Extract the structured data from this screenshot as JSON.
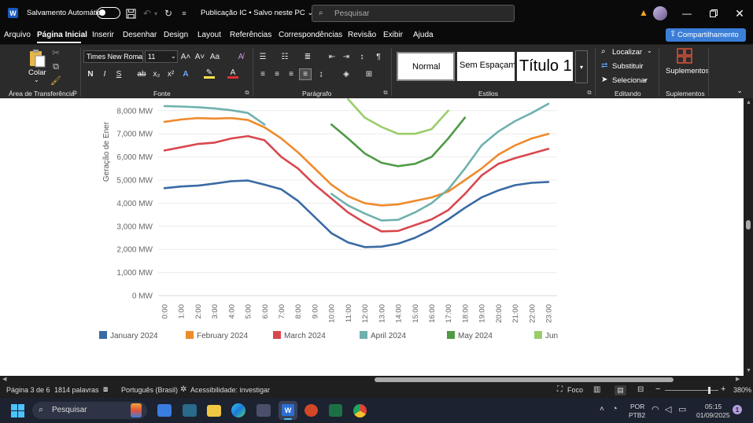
{
  "titlebar": {
    "autosave_label": "Salvamento Automático",
    "doc_title": "Publicação IC",
    "save_status": "Salvo neste PC",
    "search_placeholder": "Pesquisar"
  },
  "menu": {
    "tabs": [
      "Arquivo",
      "Página Inicial",
      "Inserir",
      "Desenhar",
      "Design",
      "Layout",
      "Referências",
      "Correspondências",
      "Revisão",
      "Exibir",
      "Ajuda"
    ],
    "share_label": "Compartilhamento"
  },
  "ribbon": {
    "paste_label": "Colar",
    "clipboard_group": "Área de Transferência",
    "font_name": "Times New Roma",
    "font_size": "11",
    "font_group": "Fonte",
    "paragraph_group": "Parágrafo",
    "styles": [
      "Normal",
      "Sem Espaçam",
      "Título 1"
    ],
    "styles_group": "Estilos",
    "find_label": "Localizar",
    "replace_label": "Substituir",
    "select_label": "Selecionar",
    "editing_group": "Editando",
    "addins_label": "Suplementos",
    "addins_group": "Suplementos"
  },
  "chart_data": {
    "type": "line",
    "ylabel": "Geração de Ener",
    "y_ticks": [
      "0 MW",
      "1,000 MW",
      "2,000 MW",
      "3,000 MW",
      "4,000 MW",
      "5,000 MW",
      "6,000 MW",
      "7,000 MW",
      "8,000 MW"
    ],
    "ylim": [
      0,
      8200
    ],
    "categories": [
      "0:00",
      "1:00",
      "2:00",
      "3:00",
      "4:00",
      "5:00",
      "6:00",
      "7:00",
      "8:00",
      "9:00",
      "10:00",
      "11:00",
      "12:00",
      "13:00",
      "14:00",
      "15:00",
      "16:00",
      "17:00",
      "18:00",
      "19:00",
      "20:00",
      "21:00",
      "22:00",
      "23:00"
    ],
    "grid": true,
    "legend_position": "bottom",
    "series": [
      {
        "name": "January 2024",
        "color": "#3a6aa4",
        "values": [
          4650,
          4720,
          4760,
          4850,
          4950,
          4980,
          4800,
          4600,
          4100,
          3400,
          2700,
          2300,
          2100,
          2120,
          2250,
          2500,
          2850,
          3300,
          3800,
          4250,
          4550,
          4780,
          4880,
          4920
        ]
      },
      {
        "name": "February 2024",
        "color": "#ef8b2c",
        "values": [
          7520,
          7620,
          7680,
          7660,
          7680,
          7600,
          7280,
          6800,
          6200,
          5500,
          4800,
          4300,
          4000,
          3900,
          3950,
          4100,
          4250,
          4500,
          5000,
          5500,
          6100,
          6500,
          6800,
          7000
        ]
      },
      {
        "name": "March 2024",
        "color": "#d9474e",
        "values": [
          6280,
          6420,
          6560,
          6620,
          6800,
          6900,
          6720,
          6000,
          5500,
          4800,
          4200,
          3600,
          3150,
          2780,
          2800,
          3050,
          3300,
          3700,
          4400,
          5200,
          5700,
          5950,
          6150,
          6350
        ]
      },
      {
        "name": "April 2024",
        "color": "#6fb1ad",
        "values": [
          8200,
          8180,
          8150,
          8100,
          8020,
          7900,
          7400,
          null,
          null,
          null,
          4400,
          3900,
          3550,
          3250,
          3280,
          3600,
          4000,
          4600,
          5500,
          6500,
          7100,
          7550,
          7900,
          8300
        ]
      },
      {
        "name": "May 2024",
        "color": "#4f9a46",
        "values": [
          null,
          null,
          null,
          null,
          null,
          null,
          null,
          null,
          null,
          null,
          7400,
          6800,
          6150,
          5750,
          5600,
          5700,
          6000,
          6800,
          7700,
          null,
          null,
          null,
          null,
          null
        ]
      },
      {
        "name": "Jun",
        "color": "#9acd6a",
        "values": [
          null,
          null,
          null,
          null,
          null,
          null,
          null,
          null,
          null,
          null,
          null,
          8500,
          7700,
          7300,
          7000,
          7000,
          7200,
          8000,
          null,
          null,
          null,
          null,
          null,
          null
        ]
      }
    ]
  },
  "status": {
    "page": "Página 3 de 6",
    "words": "1814 palavras",
    "language": "Português (Brasil)",
    "accessibility": "Acessibilidade: investigar",
    "focus": "Foco",
    "zoom": "380%"
  },
  "taskbar": {
    "search": "Pesquisar",
    "lang": "POR",
    "kb": "PTB2",
    "time": "05:15",
    "date": "01/09/2025"
  },
  "colors": {
    "accent": "#4a8ee5",
    "share": "#3b7ed8"
  }
}
